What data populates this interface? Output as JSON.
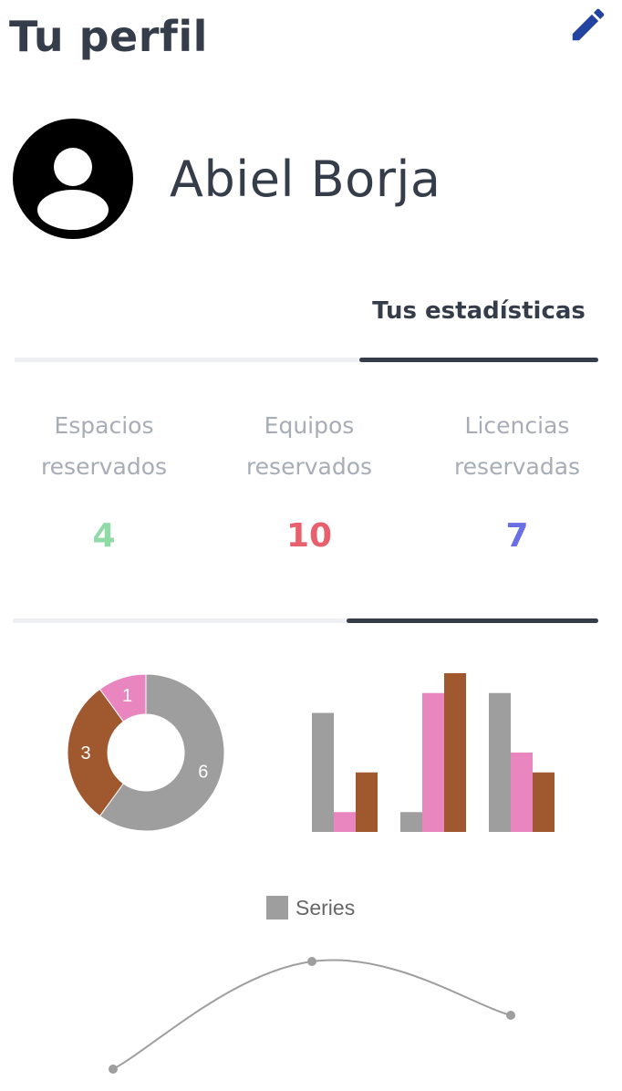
{
  "header": {
    "title": "Tu perfil",
    "edit_icon": "pencil-icon"
  },
  "profile": {
    "avatar_icon": "account-circle-icon",
    "name": "Abiel Borja"
  },
  "tabs": [
    {
      "label": "Tus estadísticas",
      "active": true
    }
  ],
  "stats": [
    {
      "label_line1": "Espacios",
      "label_line2": "reservados",
      "value": "4",
      "color": "#8fdaa6"
    },
    {
      "label_line1": "Equipos",
      "label_line2": "reservados",
      "value": "10",
      "color": "#e8606d"
    },
    {
      "label_line1": "Licencias",
      "label_line2": "reservadas",
      "value": "7",
      "color": "#6a6fe6"
    }
  ],
  "colors": {
    "text": "#363d4a",
    "muted": "#a7adb6",
    "divider": "#eef0f3",
    "gray": "#9e9e9e",
    "pink": "#e986c0",
    "brown": "#a0582f"
  },
  "chart_data": [
    {
      "type": "pie",
      "subtype": "doughnut",
      "values": [
        6,
        3,
        1
      ],
      "colors": [
        "#9e9e9e",
        "#a0582f",
        "#e986c0"
      ],
      "labels": [
        "6",
        "3",
        "1"
      ]
    },
    {
      "type": "bar",
      "groups": 3,
      "series": [
        {
          "values": [
            6,
            1,
            7
          ],
          "color": "#9e9e9e"
        },
        {
          "values": [
            1,
            7,
            4
          ],
          "color": "#e986c0"
        },
        {
          "values": [
            3,
            8,
            3
          ],
          "color": "#a0582f"
        }
      ],
      "ylim": [
        0,
        8
      ]
    },
    {
      "type": "line",
      "legend": [
        "Series"
      ],
      "legend_placement": "top",
      "series": [
        {
          "name": "Series",
          "values": [
            4,
            10,
            7
          ],
          "color": "#9e9e9e"
        }
      ],
      "ylim": [
        4,
        10
      ]
    }
  ]
}
